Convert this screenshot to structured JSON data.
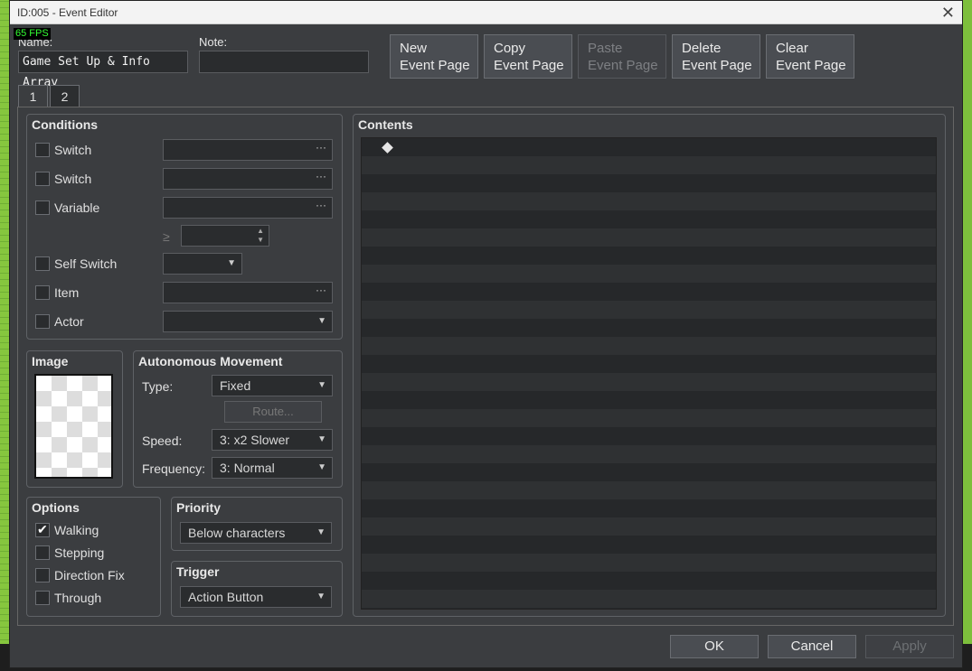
{
  "window": {
    "title": "ID:005 - Event Editor",
    "close_glyph": "✕",
    "fps": "65 FPS"
  },
  "header": {
    "name_label": "Name:",
    "name_value": "Game Set Up & Info Array",
    "note_label": "Note:",
    "note_value": "",
    "buttons": [
      {
        "line1": "New",
        "line2": "Event Page",
        "enabled": true
      },
      {
        "line1": "Copy",
        "line2": "Event Page",
        "enabled": true
      },
      {
        "line1": "Paste",
        "line2": "Event Page",
        "enabled": false
      },
      {
        "line1": "Delete",
        "line2": "Event Page",
        "enabled": true
      },
      {
        "line1": "Clear",
        "line2": "Event Page",
        "enabled": true
      }
    ]
  },
  "tabs": [
    "1",
    "2"
  ],
  "conditions": {
    "title": "Conditions",
    "switch1_label": "Switch",
    "switch2_label": "Switch",
    "variable_label": "Variable",
    "gte_symbol": "≥",
    "self_switch_label": "Self Switch",
    "item_label": "Item",
    "actor_label": "Actor",
    "ellipsis": "···",
    "dropdown_arrow": "▼",
    "spin_up": "▲",
    "spin_down": "▼"
  },
  "image": {
    "title": "Image"
  },
  "movement": {
    "title": "Autonomous Movement",
    "type_label": "Type:",
    "type_value": "Fixed",
    "route_label": "Route...",
    "speed_label": "Speed:",
    "speed_value": "3: x2 Slower",
    "frequency_label": "Frequency:",
    "frequency_value": "3: Normal"
  },
  "options": {
    "title": "Options",
    "walking": "Walking",
    "walking_checked": true,
    "stepping": "Stepping",
    "direction_fix": "Direction Fix",
    "through": "Through"
  },
  "priority": {
    "title": "Priority",
    "value": "Below characters"
  },
  "trigger": {
    "title": "Trigger",
    "value": "Action Button"
  },
  "contents": {
    "title": "Contents"
  },
  "footer": {
    "ok": "OK",
    "cancel": "Cancel",
    "apply": "Apply"
  },
  "colors": {
    "panel": "#3b3d40",
    "field": "#2a2c2e",
    "accent_green": "#7dbf3c"
  }
}
